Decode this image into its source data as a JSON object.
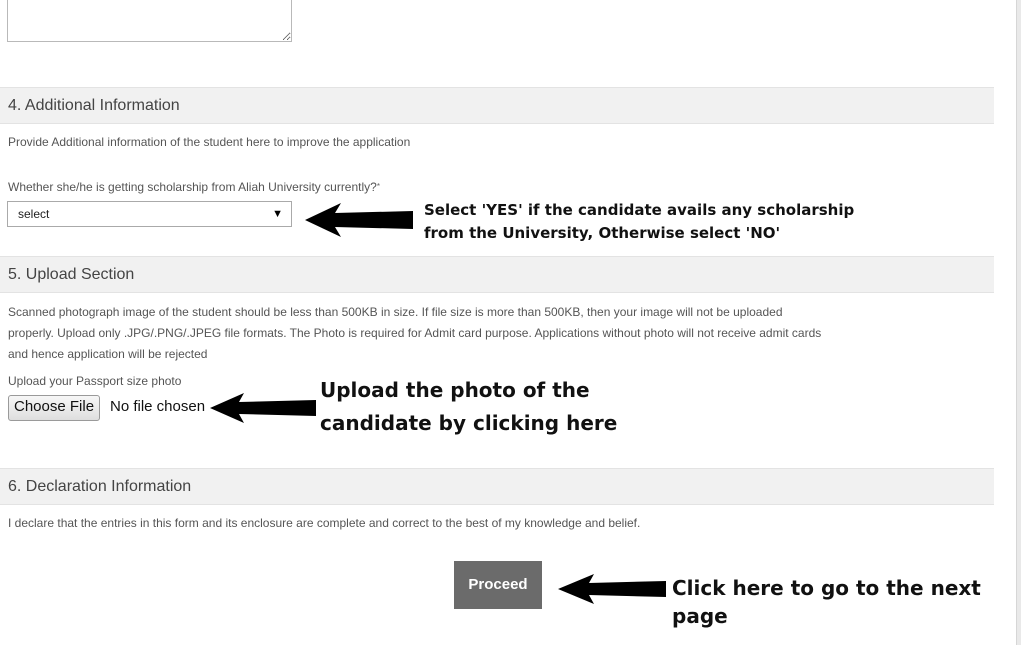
{
  "sections": {
    "additional": {
      "title": "4. Additional Information",
      "description": "Provide Additional information of the student here to improve the application",
      "scholarship_label": "Whether she/he is getting scholarship from Aliah University currently?",
      "required_mark": "*",
      "scholarship_select": {
        "value": "select",
        "caret": "▼"
      }
    },
    "upload": {
      "title": "5. Upload Section",
      "description_line1": "Scanned photograph image of the student should be less than 500KB in size. If file size is more than 500KB, then your image will not be uploaded",
      "description_line2": "properly. Upload only .JPG/.PNG/.JPEG file formats. The Photo is required for Admit card purpose. Applications without photo will not receive admit cards",
      "description_line3": "and hence application will be rejected",
      "photo_label": "Upload your Passport size photo",
      "choose_file_label": "Choose File",
      "no_file_text": "No file chosen"
    },
    "declaration": {
      "title": "6. Declaration Information",
      "text": "I declare that the entries in this form and its enclosure are complete and correct to the best of my knowledge and belief."
    }
  },
  "proceed_label": "Proceed",
  "annotations": {
    "scholarship_line1": "Select 'YES' if the candidate avails any scholarship",
    "scholarship_line2": "from the University, Otherwise select 'NO'",
    "upload_line1": "Upload the photo of the",
    "upload_line2": "candidate by clicking here",
    "proceed": "Click here to go to the next page"
  },
  "colors": {
    "section_header_bg": "#f1f1f1",
    "proceed_bg": "#6b6b6b",
    "annotation_text": "#111111"
  }
}
